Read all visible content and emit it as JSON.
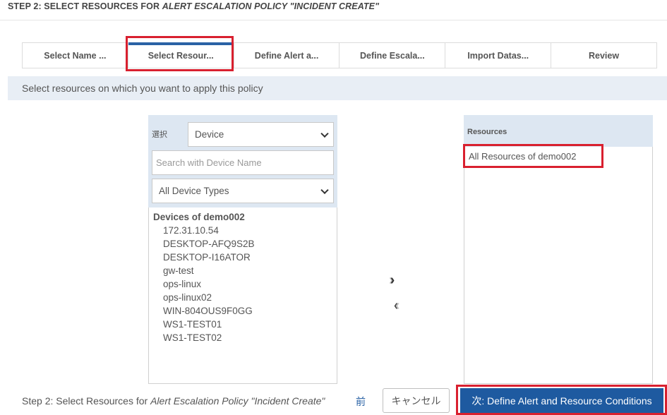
{
  "header": {
    "title_prefix": "STEP 2: SELECT RESOURCES FOR ",
    "title_policy": "ALERT ESCALATION POLICY \"INCIDENT CREATE\""
  },
  "tabs": [
    {
      "label": "Select Name ..."
    },
    {
      "label": "Select Resour..."
    },
    {
      "label": "Define Alert a..."
    },
    {
      "label": "Define Escala..."
    },
    {
      "label": "Import Datas..."
    },
    {
      "label": "Review"
    }
  ],
  "active_tab": "Select Resour...",
  "info": {
    "text": "Select resources on which you want to apply this policy"
  },
  "left_panel": {
    "select_label": "選択",
    "select_value": "Device",
    "search_placeholder": "Search with Device Name",
    "type_value": "All Device Types",
    "group_title": "Devices of demo002",
    "devices": [
      "172.31.10.54",
      "DESKTOP-AFQ9S2B",
      "DESKTOP-I16ATOR",
      "gw-test",
      "ops-linux",
      "ops-linux02",
      "WIN-804OUS9F0GG",
      "WS1-TEST01",
      "WS1-TEST02"
    ]
  },
  "move": {
    "add_icon": "double-chevron-right-icon",
    "remove_icon": "double-chevron-left-icon"
  },
  "right_panel": {
    "header": "Resources",
    "items": [
      "All Resources of demo002"
    ]
  },
  "footer": {
    "step_text": "Step 2: Select Resources for ",
    "step_policy": "Alert Escalation Policy \"Incident Create\"",
    "prev_label": "前",
    "cancel_label": "キャンセル",
    "next_label": "次: Define Alert and Resource Conditions"
  },
  "colors": {
    "accent": "#1e5aa0",
    "tab_active": "#2a62a5",
    "highlight": "#d9202f",
    "panel_head": "#dde7f2",
    "info_bar": "#e8eef5"
  }
}
